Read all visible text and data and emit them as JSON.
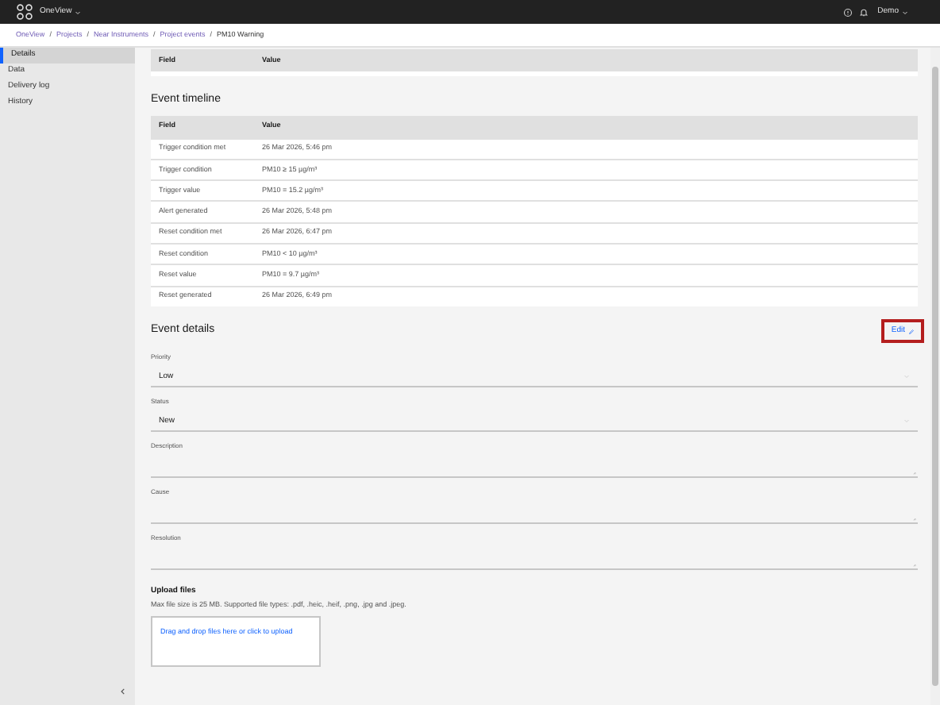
{
  "app": {
    "name": "OneView",
    "user": "Demo"
  },
  "breadcrumbs": [
    {
      "label": "OneView",
      "separator": "/"
    },
    {
      "label": "Projects",
      "separator": "/"
    },
    {
      "label": "Near Instruments",
      "separator": "/"
    },
    {
      "label": "Project events",
      "separator": "/"
    },
    {
      "label": "PM10 Warning"
    }
  ],
  "sidebar": {
    "items": [
      {
        "label": "Details",
        "selected": true
      },
      {
        "label": "Data",
        "selected": false
      },
      {
        "label": "Delivery log",
        "selected": false
      },
      {
        "label": "History",
        "selected": false
      }
    ]
  },
  "top_table": {
    "columns": [
      "Field",
      "Value"
    ]
  },
  "event_timeline": {
    "title": "Event timeline",
    "columns": [
      "Field",
      "Value"
    ],
    "rows": [
      [
        "Trigger condition met",
        "26 Mar 2026, 5:46 pm"
      ],
      [
        "Trigger condition",
        "PM10 ≥ 15 µg/m³"
      ],
      [
        "Trigger value",
        "PM10 = 15.2 µg/m³"
      ],
      [
        "Alert generated",
        "26 Mar 2026, 5:48 pm"
      ],
      [
        "Reset condition met",
        "26 Mar 2026, 6:47 pm"
      ],
      [
        "Reset condition",
        "PM10 < 10 µg/m³"
      ],
      [
        "Reset value",
        "PM10 = 9.7 µg/m³"
      ],
      [
        "Reset generated",
        "26 Mar 2026, 6:49 pm"
      ]
    ]
  },
  "event_details": {
    "title": "Event details",
    "edit_label": "Edit",
    "highlighted": true,
    "fields": [
      {
        "kind": "select",
        "label": "Priority",
        "value": "Low"
      },
      {
        "kind": "select",
        "label": "Status",
        "value": "New"
      },
      {
        "kind": "textarea",
        "label": "Description"
      },
      {
        "kind": "textarea",
        "label": "Cause"
      },
      {
        "kind": "textarea",
        "label": "Resolution"
      }
    ]
  },
  "upload": {
    "title": "Upload files",
    "hint": "Max file size is 25 MB. Supported file types: .pdf, .heic, .heif, .png, .jpg and .jpeg.",
    "drop_label": "Drag and drop files here or click to upload"
  }
}
